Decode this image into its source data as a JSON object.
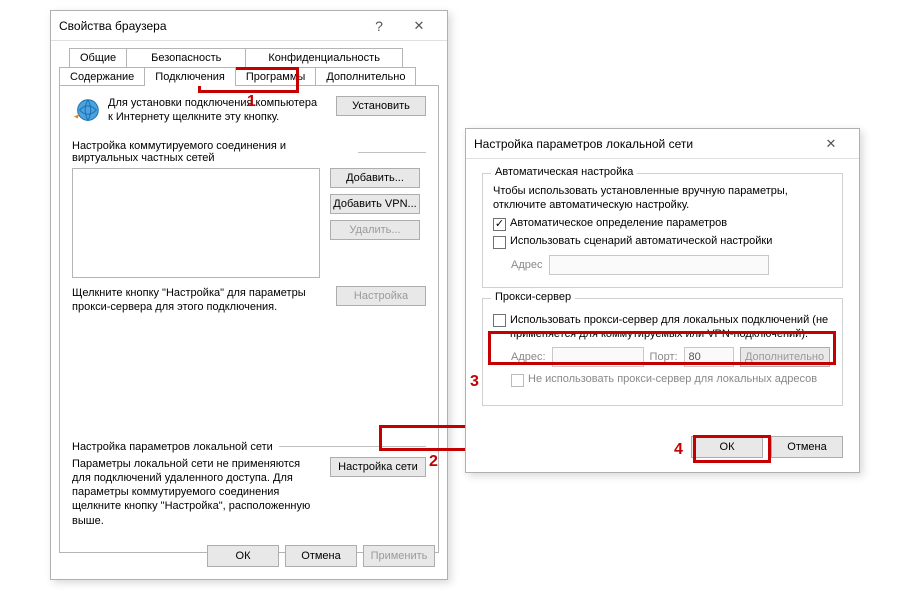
{
  "win1": {
    "title": "Свойства браузера",
    "help_glyph": "?",
    "close_glyph": "✕",
    "tabs_row1": [
      "Общие",
      "Безопасность",
      "Конфиденциальность"
    ],
    "tabs_row2": [
      "Содержание",
      "Подключения",
      "Программы",
      "Дополнительно"
    ],
    "install_text": "Для установки подключения компьютера к Интернету щелкните эту кнопку.",
    "install_btn": "Установить",
    "dialup_label": "Настройка коммутируемого соединения и виртуальных частных сетей",
    "add_btn": "Добавить...",
    "add_vpn_btn": "Добавить VPN...",
    "remove_btn": "Удалить...",
    "settings_hint": "Щелкните кнопку \"Настройка\" для параметры прокси-сервера для этого подключения.",
    "settings_btn": "Настройка",
    "lan_label": "Настройка параметров локальной сети",
    "lan_hint": "Параметры локальной сети не применяются для подключений удаленного доступа. Для параметры коммутируемого соединения щелкните кнопку \"Настройка\", расположенную выше.",
    "lan_btn": "Настройка сети",
    "ok_btn": "ОК",
    "cancel_btn": "Отмена",
    "apply_btn": "Применить",
    "callouts": {
      "n1": "1",
      "n2": "2"
    }
  },
  "win2": {
    "title": "Настройка параметров локальной сети",
    "close_glyph": "✕",
    "auto_legend": "Автоматическая настройка",
    "auto_text": "Чтобы использовать установленные вручную параметры, отключите автоматическую настройку.",
    "auto_detect": "Автоматическое определение параметров",
    "use_script": "Использовать сценарий автоматической настройки",
    "address_label": "Адрес",
    "proxy_legend": "Прокси-сервер",
    "use_proxy": "Использовать прокси-сервер для локальных подключений (не применяется для коммутируемых или VPN-подключений).",
    "addr_label": "Адрес:",
    "port_label": "Порт:",
    "port_value": "80",
    "advanced_btn": "Дополнительно",
    "bypass_local": "Не использовать прокси-сервер для локальных адресов",
    "ok_btn": "ОК",
    "cancel_btn": "Отмена",
    "callouts": {
      "n3": "3",
      "n4": "4"
    }
  }
}
